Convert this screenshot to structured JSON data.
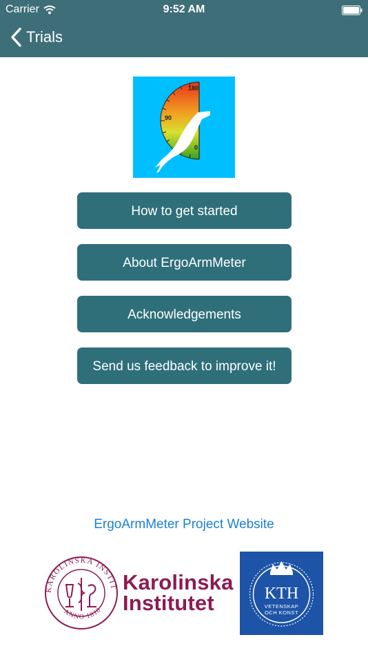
{
  "status_bar": {
    "carrier": "Carrier",
    "time": "9:52 AM",
    "wifi_icon": "wifi-icon",
    "battery_icon": "battery-icon"
  },
  "nav": {
    "back_label": "Trials",
    "back_icon": "chevron-left-icon"
  },
  "logo": {
    "gauge_ticks": [
      "180",
      "90",
      "0"
    ],
    "background_color": "#00bfff"
  },
  "menu": {
    "buttons": [
      {
        "label": "How to get started"
      },
      {
        "label": "About ErgoArmMeter"
      },
      {
        "label": "Acknowledgements"
      },
      {
        "label": "Send us feedback to improve it!"
      }
    ],
    "button_color": "#2f6f7a"
  },
  "footer": {
    "website_link": "ErgoArmMeter Project Website",
    "link_color": "#1a7fd6",
    "ki": {
      "line1": "Karolinska",
      "line2": "Institutet",
      "seal_ring_text": "KAROLINSKA INSTITUTET",
      "seal_bottom_text": "ANNO 1810",
      "color": "#8e1a52"
    },
    "kth": {
      "name": "KTH",
      "tagline1": "VETENSKAP",
      "tagline2": "OCH KONST",
      "color": "#1d54a7"
    }
  },
  "theme": {
    "header_color": "#3e6f79"
  }
}
